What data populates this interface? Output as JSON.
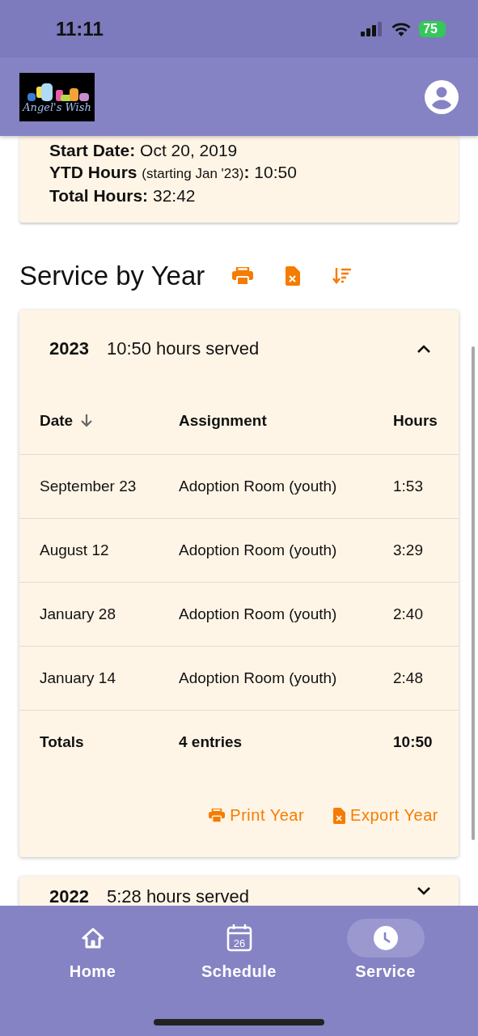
{
  "status_bar": {
    "time": "11:11",
    "battery": "75"
  },
  "app_bar": {
    "logo_text": "Angel's Wish"
  },
  "summary": [
    {
      "label": "Start Date:",
      "value": "Oct 20, 2019"
    },
    {
      "label": "YTD Hours",
      "note": "(starting Jan '23)",
      "colon": ":",
      "value": "10:50"
    },
    {
      "label": "Total Hours:",
      "value": "32:42"
    }
  ],
  "section": {
    "title": "Service by Year"
  },
  "years": [
    {
      "year": "2023",
      "summary": "10:50 hours served",
      "expanded": true,
      "columns": [
        {
          "label": "Date",
          "sorted": true
        },
        {
          "label": "Assignment",
          "sorted": false
        },
        {
          "label": "Hours",
          "sorted": false
        }
      ],
      "rows": [
        [
          "September 23",
          "Adoption Room (youth)",
          "1:53"
        ],
        [
          "August 12",
          "Adoption Room (youth)",
          "3:29"
        ],
        [
          "January 28",
          "Adoption Room (youth)",
          "2:40"
        ],
        [
          "January 14",
          "Adoption Room (youth)",
          "2:48"
        ]
      ],
      "totals": [
        "Totals",
        "4 entries",
        "10:50"
      ],
      "actions": [
        {
          "kind": "print",
          "label": "Print Year"
        },
        {
          "kind": "export",
          "label": "Export Year"
        }
      ]
    },
    {
      "year": "2022",
      "summary": "5:28 hours served",
      "expanded": false
    }
  ],
  "nav": [
    {
      "kind": "home",
      "label": "Home",
      "selected": false
    },
    {
      "kind": "calendar",
      "label": "Schedule",
      "icon_text": "26",
      "selected": false
    },
    {
      "kind": "clock",
      "label": "Service",
      "selected": true
    }
  ]
}
